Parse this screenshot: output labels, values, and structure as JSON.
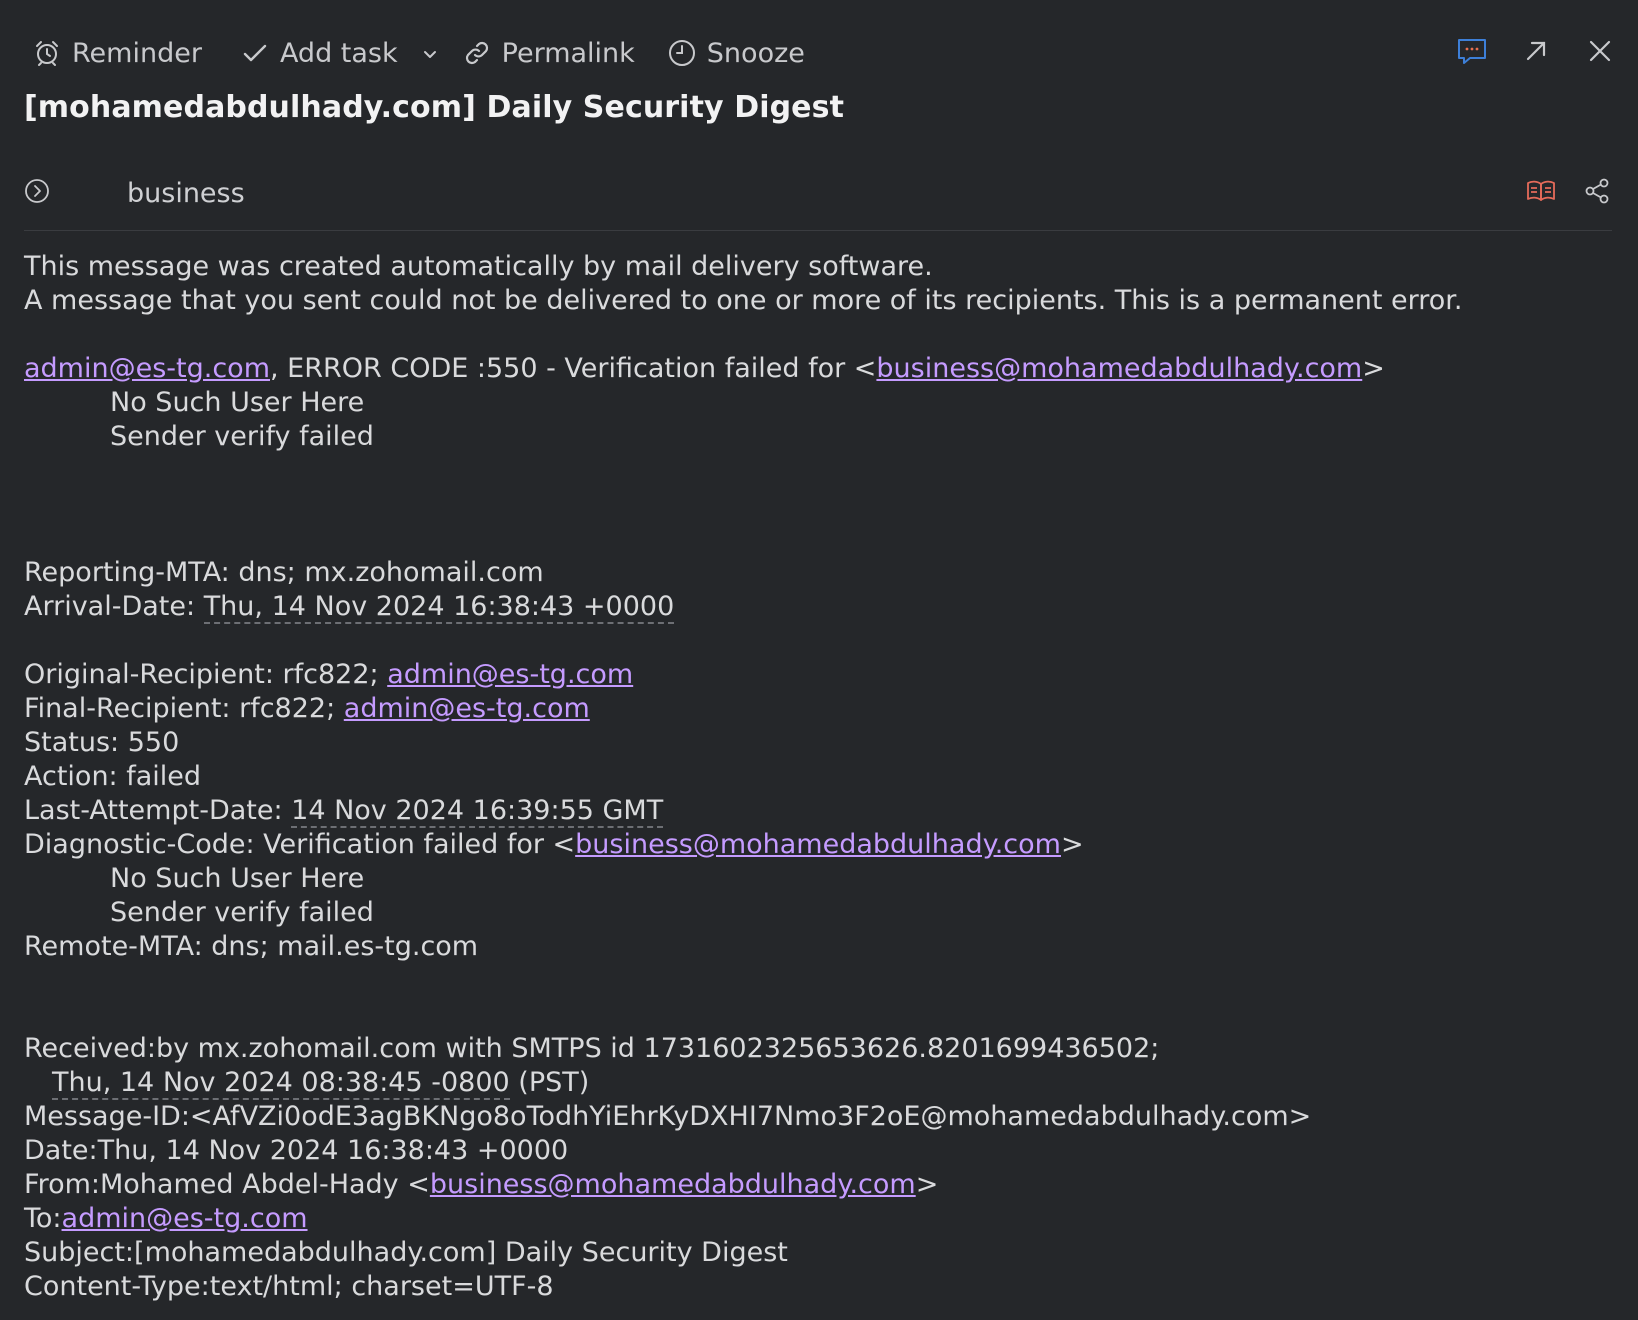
{
  "toolbar": {
    "reminder": "Reminder",
    "add_task": "Add task",
    "permalink": "Permalink",
    "snooze": "Snooze",
    "icons": {
      "reminder": "alarm-clock-icon",
      "add_task": "check-icon",
      "add_task_menu": "chevron-down-icon",
      "permalink": "link-icon",
      "snooze": "clock-icon",
      "comments": "chat-bubble-icon",
      "popout": "arrow-up-right-icon",
      "close": "close-icon"
    },
    "accent_colors": {
      "comments": "#3d7fd8"
    }
  },
  "subject": "[mohamedabdulhady.com] Daily Security Digest",
  "header": {
    "folder": "business",
    "icons": {
      "expand": "circle-chevron-right-icon",
      "reader_view": "open-book-icon",
      "share": "share-icon"
    },
    "accent_colors": {
      "reader_view": "#e56b5a"
    }
  },
  "body": {
    "intro1": "This message was created automatically by mail delivery software.",
    "intro2": "A message that you sent could not be delivered to one or more of its recipients. This is a permanent error.",
    "error_email": "admin@es-tg.com",
    "error_text": ", ERROR CODE :550 - Verification failed for <",
    "error_target": "business@mohamedabdulhady.com",
    "error_close": ">",
    "no_such_user": "No Such User Here",
    "sender_verify": "Sender verify failed",
    "reporting_mta": "Reporting-MTA: dns; mx.zohomail.com",
    "arrival_label": "Arrival-Date: ",
    "arrival_value": "Thu, 14 Nov 2024 16:38:43 +0000",
    "orig_recipient_label": "Original-Recipient: rfc822; ",
    "orig_recipient": "admin@es-tg.com",
    "final_recipient_label": "Final-Recipient: rfc822; ",
    "final_recipient": "admin@es-tg.com",
    "status": "Status: 550",
    "action": "Action: failed",
    "last_attempt_label": "Last-Attempt-Date: ",
    "last_attempt_value": "14 Nov 2024 16:39:55 GMT",
    "diagnostic_label": "Diagnostic-Code: Verification failed for <",
    "diagnostic_email": "business@mohamedabdulhady.com",
    "diagnostic_close": ">",
    "diag_no_such_user": "No Such User Here",
    "diag_sender_verify": "Sender verify failed",
    "remote_mta": "Remote-MTA: dns; mail.es-tg.com",
    "received": "Received:by mx.zohomail.com with SMTPS id 1731602325653626.8201699436502;",
    "received_date": "Thu, 14 Nov 2024 08:38:45 -0800",
    "received_tz": " (PST)",
    "message_id": "Message-ID:<AfVZi0odE3agBKNgo8oTodhYiEhrKyDXHI7Nmo3F2oE@mohamedabdulhady.com>",
    "date": "Date:Thu, 14 Nov 2024 16:38:43 +0000",
    "from_label": "From:Mohamed Abdel-Hady <",
    "from_email": "business@mohamedabdulhady.com",
    "from_close": ">",
    "to_label": "To:",
    "to_email": "admin@es-tg.com",
    "subject_line": "Subject:[mohamedabdulhady.com] Daily Security Digest",
    "content_type": "Content-Type:text/html; charset=UTF-8"
  },
  "colors": {
    "background": "#25272a",
    "link": "#c59bff",
    "text": "#d9dadc"
  }
}
